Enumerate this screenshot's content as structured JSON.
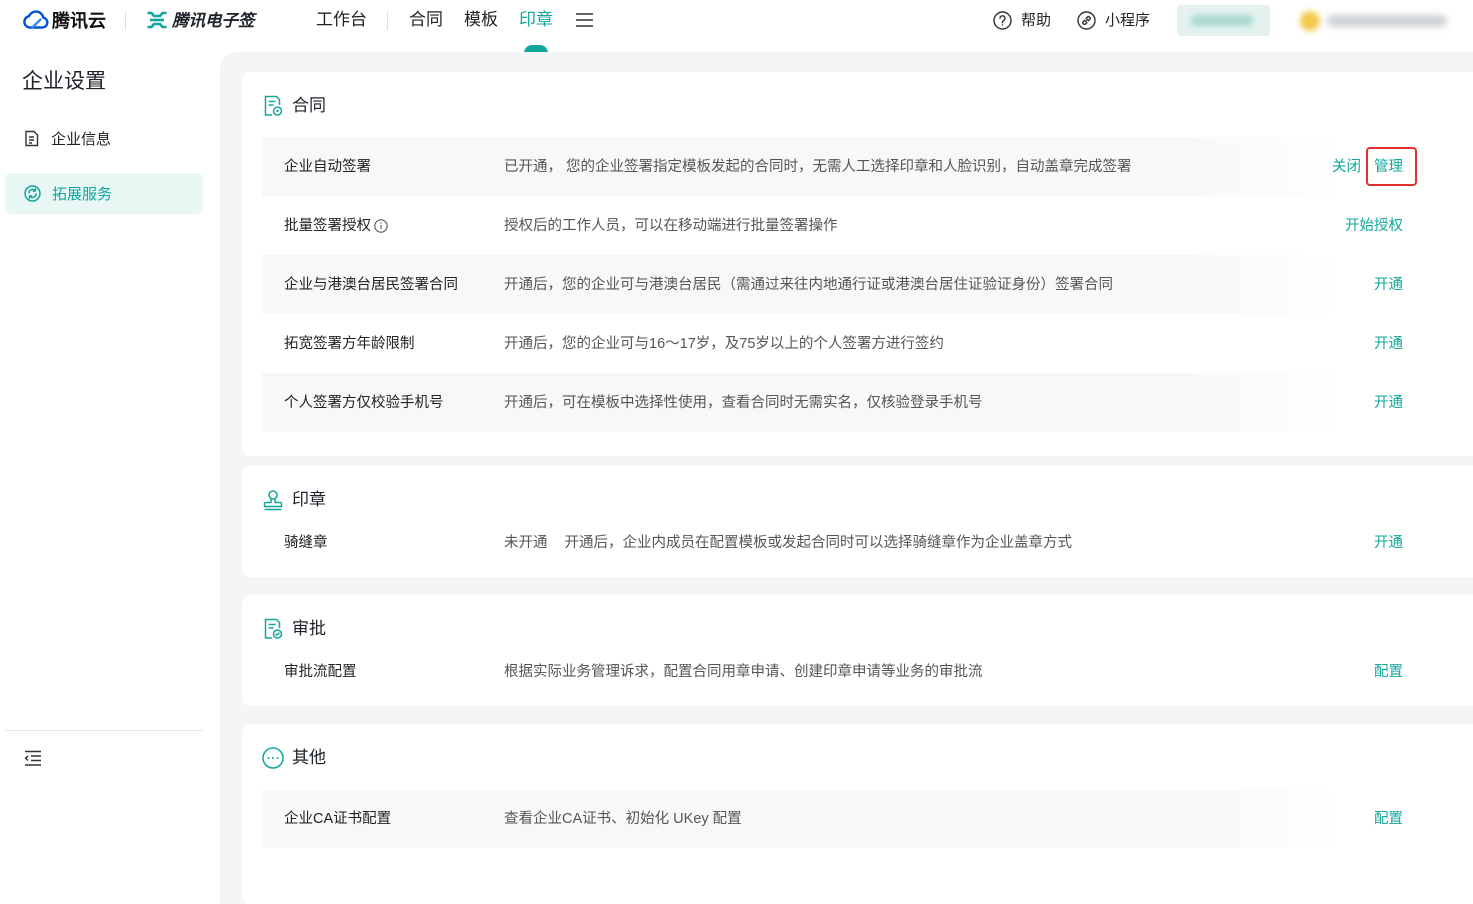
{
  "header": {
    "brand": {
      "cloud_name": "腾讯云",
      "product_name": "腾讯电子签",
      "cloud_icon": "tencent-cloud-icon",
      "product_icon": "esign-logo-icon"
    },
    "nav": [
      {
        "label": "工作台"
      },
      {
        "label": "合同"
      },
      {
        "label": "模板"
      },
      {
        "label": "印章",
        "active": true
      }
    ],
    "menu_icon": "menu-icon",
    "help": {
      "label": "帮助",
      "icon": "help-circle-icon"
    },
    "miniprogram": {
      "label": "小程序",
      "icon": "link-icon"
    }
  },
  "sidebar": {
    "title": "企业设置",
    "items": [
      {
        "label": "企业信息",
        "icon": "document-icon"
      },
      {
        "label": "拓展服务",
        "icon": "extension-services-icon",
        "active": true
      }
    ],
    "collapse_icon": "collapse-sidebar-icon"
  },
  "sections": [
    {
      "title": "合同",
      "icon": "contract-icon",
      "rows": [
        {
          "name": "企业自动签署",
          "description": "已开通， 您的企业签署指定模板发起的合同时，无需人工选择印章和人脸识别，自动盖章完成签署",
          "actions": [
            {
              "label": "关闭"
            },
            {
              "label": "管理",
              "highlighted": true
            }
          ]
        },
        {
          "name": "批量签署授权",
          "info_icon": "info-icon",
          "description": "授权后的工作人员，可以在移动端进行批量签署操作",
          "actions": [
            {
              "label": "开始授权"
            }
          ]
        },
        {
          "name": "企业与港澳台居民签署合同",
          "description": "开通后，您的企业可与港澳台居民（需通过来往内地通行证或港澳台居住证验证身份）签署合同",
          "actions": [
            {
              "label": "开通"
            }
          ]
        },
        {
          "name": "拓宽签署方年龄限制",
          "description": "开通后，您的企业可与16～17岁，及75岁以上的个人签署方进行签约",
          "actions": [
            {
              "label": "开通"
            }
          ]
        },
        {
          "name": "个人签署方仅校验手机号",
          "description": "开通后，可在模板中选择性使用，查看合同时无需实名，仅核验登录手机号",
          "actions": [
            {
              "label": "开通"
            }
          ]
        }
      ]
    },
    {
      "title": "印章",
      "icon": "stamp-icon",
      "rows": [
        {
          "name": "骑缝章",
          "status": "未开通",
          "description": "开通后，企业内成员在配置模板或发起合同时可以选择骑缝章作为企业盖章方式",
          "actions": [
            {
              "label": "开通"
            }
          ]
        }
      ]
    },
    {
      "title": "审批",
      "icon": "approval-icon",
      "rows": [
        {
          "name": "审批流配置",
          "description": "根据实际业务管理诉求，配置合同用章申请、创建印章申请等业务的审批流",
          "actions": [
            {
              "label": "配置"
            }
          ]
        }
      ]
    },
    {
      "title": "其他",
      "icon": "more-icon",
      "rows": [
        {
          "name": "企业CA证书配置",
          "description": "查看企业CA证书、初始化 UKey 配置",
          "actions": [
            {
              "label": "配置"
            }
          ]
        }
      ]
    }
  ],
  "colors": {
    "accent": "#12a79c",
    "highlight_border": "#e3302f",
    "active_item_bg": "#e8f6f4",
    "row_shaded_bg": "#f7f8fa",
    "page_bg": "#f4f5f7"
  }
}
